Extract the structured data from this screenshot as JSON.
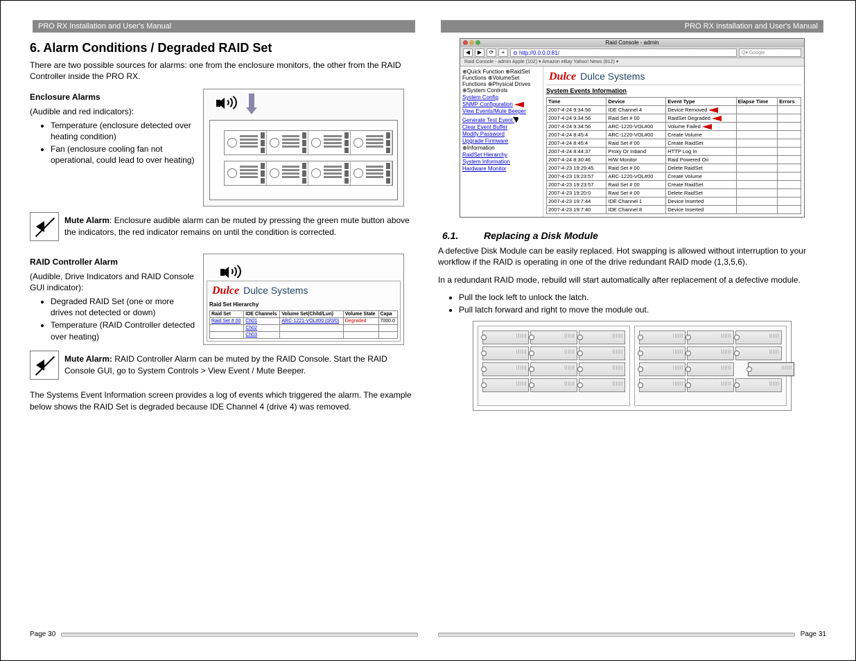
{
  "header": "PRO RX Installation and User's Manual",
  "left": {
    "h2": "6. Alarm Conditions / Degraded RAID Set",
    "intro": "There are two possible sources for alarms: one from the enclosure monitors, the other from the RAID Controller inside the PRO RX.",
    "enc_title": "Enclosure Alarms",
    "enc_sub": "(Audible and red indicators):",
    "enc_b1": "Temperature (enclosure detected over heating condition)",
    "enc_b2": "Fan (enclosure cooling fan not operational, could lead to over heating)",
    "mute1_label": "Mute Alarm",
    "mute1_text": ": Enclosure audible alarm can be muted by pressing the green mute button above the indicators, the red indicator remains on until the condition is corrected.",
    "raid_title": "RAID Controller Alarm",
    "raid_sub": "(Audible, Drive Indicators and RAID Console GUI indicator):",
    "raid_b1": "Degraded RAID Set (one or more drives not detected or down)",
    "raid_b2": "Temperature (RAID Controller detected over heating)",
    "mute2_label": "Mute Alarm:",
    "mute2_text": " RAID Controller Alarm can be muted by the RAID Console.  Start the RAID Console GUI, go to System Controls > View Event / Mute Beeper.",
    "events_para": "The Systems Event Information screen provides a log of events which triggered the alarm.  The example below shows the RAID Set is degraded because IDE Channel 4 (drive 4) was removed.",
    "hier": {
      "title": "Raid Set Hierarchy",
      "cols": [
        "Raid Set",
        "IDE Channels",
        "Volume Set(Ch/Id/Lun)",
        "Volume State",
        "Capa"
      ],
      "r0": [
        "Raid Set # 00",
        "Ch01",
        "ARC-1221-VOL#00 (0/0/0)",
        "Degraded",
        "7000.0"
      ],
      "r1": [
        "",
        "Ch02",
        "",
        "",
        ""
      ],
      "r2": [
        "",
        "Ch03",
        "",
        "",
        ""
      ]
    },
    "footer": "Page 30"
  },
  "right": {
    "browser": {
      "title": "Raid Console - admin",
      "url": "http://0.0.0.0:81/",
      "search": "Google",
      "bookmarks": "Raid Console - admin    Apple (102) ▾   Amazon   eBay   Yahoo!   News (812) ▾",
      "side": {
        "cat1": "⊕Quick Function",
        "cat2": "⊕RaidSet Functions",
        "cat3": "⊕VolumeSet Functions",
        "cat4": "⊕Physical Drives",
        "cat5": "⊕System Controls",
        "l1": "System Config",
        "l2": "SNMP Configuration",
        "l3": "View Events/Mute Beeper",
        "l4": "Generate Test Event",
        "l5": "Clear Event Buffer",
        "l6": "Modify Password",
        "l7": "Upgrade Firmware",
        "cat6": "⊕Information",
        "l8": "RaidSet Hierarchy",
        "l9": "System Information",
        "l10": "Hardware Monitor"
      },
      "sei": "System Events Information",
      "event_cols": [
        "Time",
        "Device",
        "Event Type",
        "Elapse Time",
        "Errors"
      ],
      "events": [
        {
          "t": "2007-4-24 9:34:56",
          "d": "IDE Channel 4",
          "e": "Device Removed",
          "arrow": true
        },
        {
          "t": "2007-4-24 9:34:56",
          "d": "Raid Set # 00",
          "e": "RaidSet Degraded",
          "arrow": true
        },
        {
          "t": "2007-4-24 9:34:56",
          "d": "ARC-1220-VOL#00",
          "e": "Volume Failed",
          "arrow": true
        },
        {
          "t": "2007-4-24 8:45:4",
          "d": "ARC-1220-VOL#00",
          "e": "Create Volume"
        },
        {
          "t": "2007-4-24 8:45:4",
          "d": "Raid Set # 00",
          "e": "Create RaidSet"
        },
        {
          "t": "2007-4-24 8:44:37",
          "d": "Proxy Or Inband",
          "e": "HTTP Log In"
        },
        {
          "t": "2007-4-24 8:30:46",
          "d": "H/W Monitor",
          "e": "Raid Powered On"
        },
        {
          "t": "2007-4-23 19:29:45",
          "d": "Raid Set # 00",
          "e": "Delete RaidSet"
        },
        {
          "t": "2007-4-23 19:23:57",
          "d": "ARC-1220-VOL#00",
          "e": "Create Volume"
        },
        {
          "t": "2007-4-23 19:23:57",
          "d": "Raid Set # 00",
          "e": "Create RaidSet"
        },
        {
          "t": "2007-4-23 19:20:0",
          "d": "Raid Set # 00",
          "e": "Delete RaidSet"
        },
        {
          "t": "2007-4-23 19:7:44",
          "d": "IDE Channel 1",
          "e": "Device Inserted"
        },
        {
          "t": "2007-4-23 19:7:40",
          "d": "IDE Channel 8",
          "e": "Device Inserted"
        }
      ]
    },
    "dulce": "Dulce",
    "dulce_sys": "Dulce Systems",
    "h3_num": "6.1.",
    "h3_title": "Replacing a Disk Module",
    "p1": "A defective Disk Module can be easily replaced.  Hot swapping is allowed without interruption to your workflow if the RAID is operating in one of the drive redundant RAID mode (1,3,5,6).",
    "p2": "In a redundant RAID mode, rebuild will start automatically after replacement of a defective module.",
    "b1": "Pull the lock left to unlock the latch.",
    "b2": "Pull latch forward and right to move the module out.",
    "footer": "Page 31"
  }
}
